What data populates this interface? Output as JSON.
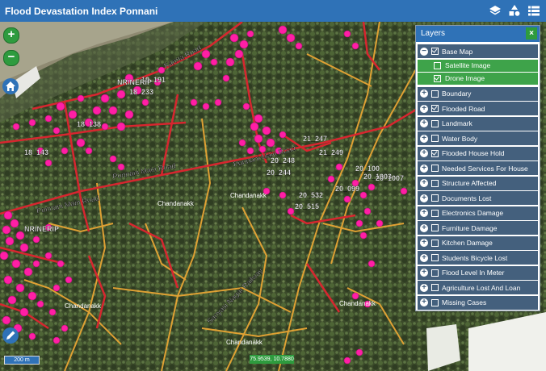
{
  "app": {
    "title": "Flood Devastation Index Ponnani"
  },
  "toolbar": {
    "icons": [
      "layers-icon",
      "shapes-icon",
      "list-icon"
    ]
  },
  "map": {
    "roads": [
      {
        "label": "Ponnani Main Road"
      },
      {
        "label": "Ponnani Main Road"
      },
      {
        "label": "Ponnani Main Road"
      },
      {
        "label": "Karma Road"
      },
      {
        "label": "Sanyasi Nagar Railway"
      }
    ],
    "place_labels": [
      "Chandanakk",
      "Chandanakk",
      "Chandanakk",
      "Chandanakk",
      "Chandanakk"
    ],
    "house_labels": [
      "19_191",
      "18_138",
      "18_143",
      "18_233",
      "20_244",
      "20_248",
      "20_532",
      "20_515",
      "21_247",
      "21_249",
      "NRINERIP",
      "NRINERIP",
      "20_100",
      "20_099",
      "20_1003",
      "20_1007"
    ],
    "marker_color": "#ff1fa5",
    "flooded_road_color": "#d7262f",
    "boundary_color": "#e8a534"
  },
  "controls": {
    "zoom_in": "+",
    "zoom_out": "−"
  },
  "scale": {
    "label": "200 m"
  },
  "coordinates": {
    "text": "75.9539, 10.7880"
  },
  "layers_panel": {
    "title": "Layers",
    "close": "×",
    "base_map": {
      "label": "Base Map",
      "checked": true
    },
    "base_options": [
      {
        "label": "Satellite Image",
        "checked": false
      },
      {
        "label": "Drone Image",
        "checked": true
      }
    ],
    "items": [
      {
        "label": "Boundary",
        "checked": false
      },
      {
        "label": "Flooded Road",
        "checked": true
      },
      {
        "label": "Landmark",
        "checked": false
      },
      {
        "label": "Water Body",
        "checked": false
      },
      {
        "label": "Flooded House Hold",
        "checked": true
      },
      {
        "label": "Needed Services For House",
        "checked": false
      },
      {
        "label": "Structure Affected",
        "checked": false
      },
      {
        "label": "Documents Lost",
        "checked": false
      },
      {
        "label": "Electronics Damage",
        "checked": false
      },
      {
        "label": "Furniture Damage",
        "checked": false
      },
      {
        "label": "Kitchen Damage",
        "checked": false
      },
      {
        "label": "Students Bicycle Lost",
        "checked": false
      },
      {
        "label": "Flood Level In Meter",
        "checked": false
      },
      {
        "label": "Agriculture Lost And Loan",
        "checked": false
      },
      {
        "label": "Missing Cases",
        "checked": false
      }
    ]
  }
}
